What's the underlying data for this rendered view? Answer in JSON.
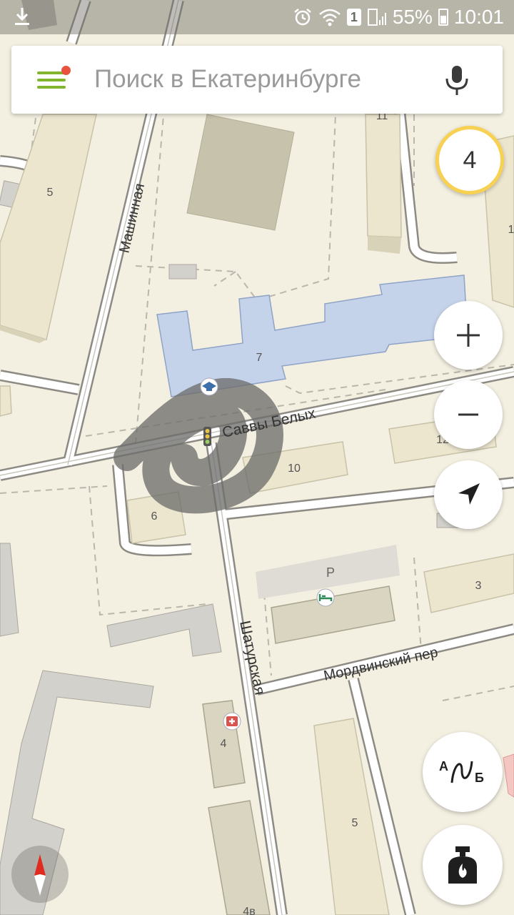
{
  "status_bar": {
    "sim_label": "1",
    "battery": "55%",
    "time": "10:01"
  },
  "search": {
    "placeholder": "Поиск в Екатеринбурге"
  },
  "traffic_level": "4",
  "controls": {
    "zoom_in": "+",
    "zoom_out": "−",
    "route_a": "А",
    "route_b": "Б"
  },
  "map": {
    "streets": {
      "mashinnaya": "Машинная",
      "savvy_belykh": "Саввы Белых",
      "shaturskaya": "Шатурская",
      "mordvinsky": "Мордвинский пер"
    },
    "building_numbers": {
      "b5_left": "5",
      "b11": "11",
      "b1_right": "1",
      "b7": "7",
      "b12": "12",
      "b10": "10",
      "b6": "6",
      "b3": "3",
      "b4": "4",
      "b5_bottom": "5",
      "b4b": "4в"
    },
    "parking_label": "P"
  },
  "colors": {
    "map_background": "#f3efe1",
    "accent_green": "#82b52d",
    "notification_dot": "#e9533d",
    "traffic_ring": "#f8d052",
    "school_building": "#c5d3ea",
    "hospital_red": "#d9534f"
  },
  "icons": {
    "menu": "hamburger-menu-icon",
    "mic": "microphone-icon",
    "location": "navigation-arrow-icon",
    "route": "route-ab-icon",
    "fuel": "fuel-station-icon",
    "compass": "compass-icon",
    "school": "school-icon",
    "hotel": "hotel-icon",
    "hospital": "hospital-icon",
    "traffic_light": "traffic-light-icon"
  }
}
